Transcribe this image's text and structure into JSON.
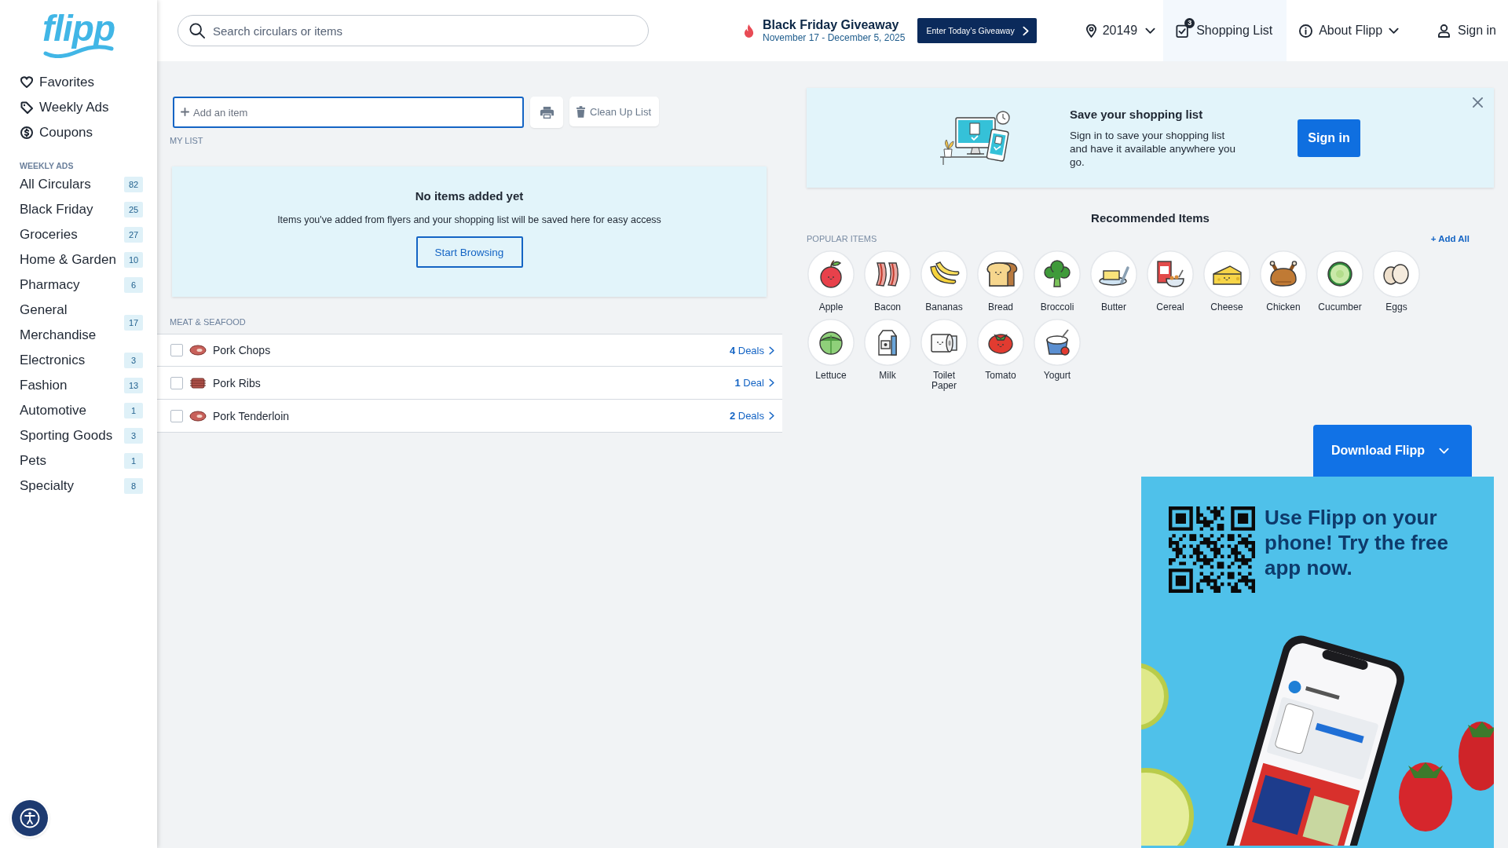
{
  "sidebar": {
    "logo": "flipp",
    "nav": [
      {
        "kind": "favorites",
        "label": "Favorites"
      },
      {
        "kind": "ads",
        "label": "Weekly Ads"
      },
      {
        "kind": "coupons",
        "label": "Coupons"
      }
    ],
    "section_label": "WEEKLY ADS",
    "categories": [
      {
        "label": "All Circulars",
        "count": "82"
      },
      {
        "label": "Black Friday",
        "count": "25"
      },
      {
        "label": "Groceries",
        "count": "27"
      },
      {
        "label": "Home & Garden",
        "count": "10"
      },
      {
        "label": "Pharmacy",
        "count": "6"
      },
      {
        "label": "General Merchandise",
        "count": "17"
      },
      {
        "label": "Electronics",
        "count": "3"
      },
      {
        "label": "Fashion",
        "count": "13"
      },
      {
        "label": "Automotive",
        "count": "1"
      },
      {
        "label": "Sporting Goods",
        "count": "3"
      },
      {
        "label": "Pets",
        "count": "1"
      },
      {
        "label": "Specialty",
        "count": "8"
      }
    ]
  },
  "header": {
    "search": {
      "placeholder": "Search circulars or items"
    },
    "promo": {
      "title": "Black Friday Giveaway",
      "dates": "November 17 - December 5, 2025",
      "button": "Enter Today’s Giveaway"
    },
    "location": "20149",
    "nav": [
      {
        "kind": "list",
        "label": "Shopping List",
        "badge": "3",
        "selected": true
      },
      {
        "kind": "about",
        "label": "About Flipp",
        "selected": false
      }
    ],
    "sign_in": "Sign in"
  },
  "list": {
    "add_field": {
      "placeholder": "Add an item"
    },
    "print_button": {
      "disabled": true
    },
    "clean_up_button": {
      "label": "Clean Up List",
      "disabled": true
    },
    "heading": "MY LIST",
    "empty_state": {
      "title": "No items added yet",
      "message": "Items you've added from flyers and your shopping list will be saved here for easy access",
      "button": "Start Browsing"
    },
    "sections": [
      {
        "heading": "MEAT & SEAFOOD",
        "rows": [
          {
            "kind": "chop",
            "name": "Pork Chops",
            "deals": "**4** Deals",
            "checked": false
          },
          {
            "kind": "ribs",
            "name": "Pork Ribs",
            "deals": "**1** Deal",
            "checked": false
          },
          {
            "kind": "chop",
            "name": "Pork Tenderloin",
            "deals": "**2** Deals",
            "checked": false
          }
        ]
      }
    ]
  },
  "save_banner": {
    "title": "Save your shopping list",
    "message": "Sign in to save your shopping list and have it available anywhere you go.",
    "button": "Sign in"
  },
  "recommended": {
    "title": "Recommended Items",
    "section_label": "POPULAR ITEMS",
    "add_all": "+ Add All",
    "items": [
      {
        "kind": "apple",
        "label": "Apple"
      },
      {
        "kind": "bacon",
        "label": "Bacon"
      },
      {
        "kind": "banana",
        "label": "Bananas"
      },
      {
        "kind": "bread",
        "label": "Bread"
      },
      {
        "kind": "broccoli",
        "label": "Broccoli"
      },
      {
        "kind": "butter",
        "label": "Butter"
      },
      {
        "kind": "cereal",
        "label": "Cereal"
      },
      {
        "kind": "cheese",
        "label": "Cheese"
      },
      {
        "kind": "chicken",
        "label": "Chicken"
      },
      {
        "kind": "cucumber",
        "label": "Cucumber"
      },
      {
        "kind": "eggs",
        "label": "Eggs"
      },
      {
        "kind": "lettuce",
        "label": "Lettuce"
      },
      {
        "kind": "milk",
        "label": "Milk"
      },
      {
        "kind": "paper",
        "label": "Toilet Paper"
      },
      {
        "kind": "tomato",
        "label": "Tomato"
      },
      {
        "kind": "yogurt",
        "label": "Yogurt"
      }
    ]
  },
  "download": {
    "button": "Download Flipp",
    "headline": "Use Flipp on your phone! Try the free app now."
  }
}
